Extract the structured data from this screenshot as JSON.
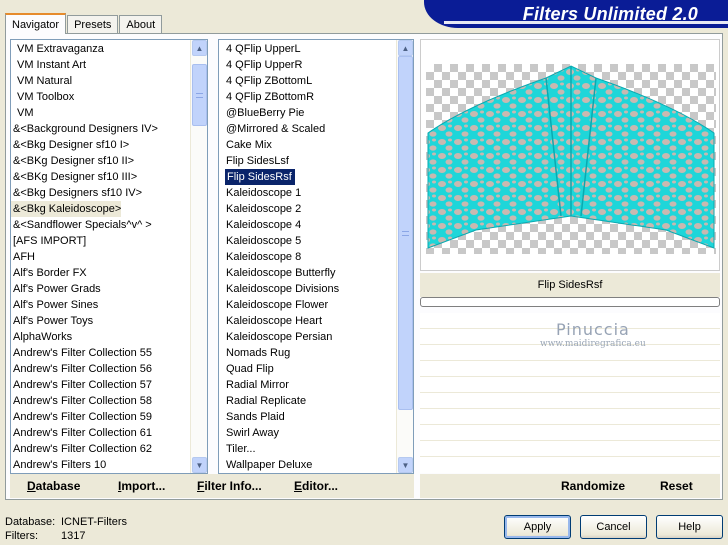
{
  "app_title": "Filters Unlimited 2.0",
  "tabs": [
    "Navigator",
    "Presets",
    "About"
  ],
  "categories": [
    {
      "label": "VM Extravaganza",
      "indent": true
    },
    {
      "label": "VM Instant Art",
      "indent": true
    },
    {
      "label": "VM Natural",
      "indent": true
    },
    {
      "label": "VM Toolbox",
      "indent": true
    },
    {
      "label": "VM",
      "indent": true
    },
    {
      "label": "&<Background Designers IV>",
      "indent": false
    },
    {
      "label": "&<Bkg Designer sf10 I>",
      "indent": false
    },
    {
      "label": "&<BKg Designer sf10 II>",
      "indent": false
    },
    {
      "label": "&<BKg Designer sf10 III>",
      "indent": false
    },
    {
      "label": "&<Bkg Designers sf10 IV>",
      "indent": false
    },
    {
      "label": "&<Bkg Kaleidoscope>",
      "indent": false,
      "highlighted": true
    },
    {
      "label": "&<Sandflower Specials^v^ >",
      "indent": false
    },
    {
      "label": "[AFS IMPORT]",
      "indent": false
    },
    {
      "label": "AFH",
      "indent": false
    },
    {
      "label": "Alf's Border FX",
      "indent": false
    },
    {
      "label": "Alf's Power Grads",
      "indent": false
    },
    {
      "label": "Alf's Power Sines",
      "indent": false
    },
    {
      "label": "Alf's Power Toys",
      "indent": false
    },
    {
      "label": "AlphaWorks",
      "indent": false
    },
    {
      "label": "Andrew's Filter Collection 55",
      "indent": false
    },
    {
      "label": "Andrew's Filter Collection 56",
      "indent": false
    },
    {
      "label": "Andrew's Filter Collection 57",
      "indent": false
    },
    {
      "label": "Andrew's Filter Collection 58",
      "indent": false
    },
    {
      "label": "Andrew's Filter Collection 59",
      "indent": false
    },
    {
      "label": "Andrew's Filter Collection 61",
      "indent": false
    },
    {
      "label": "Andrew's Filter Collection 62",
      "indent": false
    },
    {
      "label": "Andrew's Filters 10",
      "indent": false
    }
  ],
  "filters": [
    {
      "label": "4 QFlip UpperL"
    },
    {
      "label": "4 QFlip UpperR"
    },
    {
      "label": "4 QFlip ZBottomL"
    },
    {
      "label": "4 QFlip ZBottomR"
    },
    {
      "label": "@BlueBerry Pie"
    },
    {
      "label": "@Mirrored & Scaled"
    },
    {
      "label": "Cake Mix"
    },
    {
      "label": "Flip SidesLsf"
    },
    {
      "label": "Flip SidesRsf",
      "selected": true
    },
    {
      "label": "Kaleidoscope 1"
    },
    {
      "label": "Kaleidoscope 2"
    },
    {
      "label": "Kaleidoscope 4"
    },
    {
      "label": "Kaleidoscope 5"
    },
    {
      "label": "Kaleidoscope 8"
    },
    {
      "label": "Kaleidoscope Butterfly"
    },
    {
      "label": "Kaleidoscope Divisions"
    },
    {
      "label": "Kaleidoscope Flower"
    },
    {
      "label": "Kaleidoscope Heart"
    },
    {
      "label": "Kaleidoscope Persian"
    },
    {
      "label": "Nomads Rug"
    },
    {
      "label": "Quad Flip"
    },
    {
      "label": "Radial Mirror"
    },
    {
      "label": "Radial Replicate"
    },
    {
      "label": "Sands Plaid"
    },
    {
      "label": "Swirl Away"
    },
    {
      "label": "Tiler..."
    },
    {
      "label": "Wallpaper Deluxe"
    }
  ],
  "preview": {
    "filter_name": "Flip SidesRsf",
    "progress": 0,
    "colors": {
      "cyan": "#1ed6d9",
      "spots": "#c9b8b0"
    }
  },
  "watermark": {
    "line1": "Pinuccia",
    "line2": "www.maidiregrafica.eu"
  },
  "left_toolbar": {
    "database": {
      "u": "D",
      "rest": "atabase"
    },
    "import": {
      "u": "I",
      "rest": "mport..."
    },
    "filter_info": {
      "u": "F",
      "rest": "ilter Info..."
    },
    "editor": {
      "u": "E",
      "rest": "ditor..."
    }
  },
  "right_toolbar": {
    "randomize": "Randomize",
    "reset": "Reset"
  },
  "status": {
    "database_label": "Database:",
    "database_value": "ICNET-Filters",
    "filters_label": "Filters:",
    "filters_value": "1317"
  },
  "buttons": {
    "apply": "Apply",
    "cancel": "Cancel",
    "help": "Help"
  }
}
